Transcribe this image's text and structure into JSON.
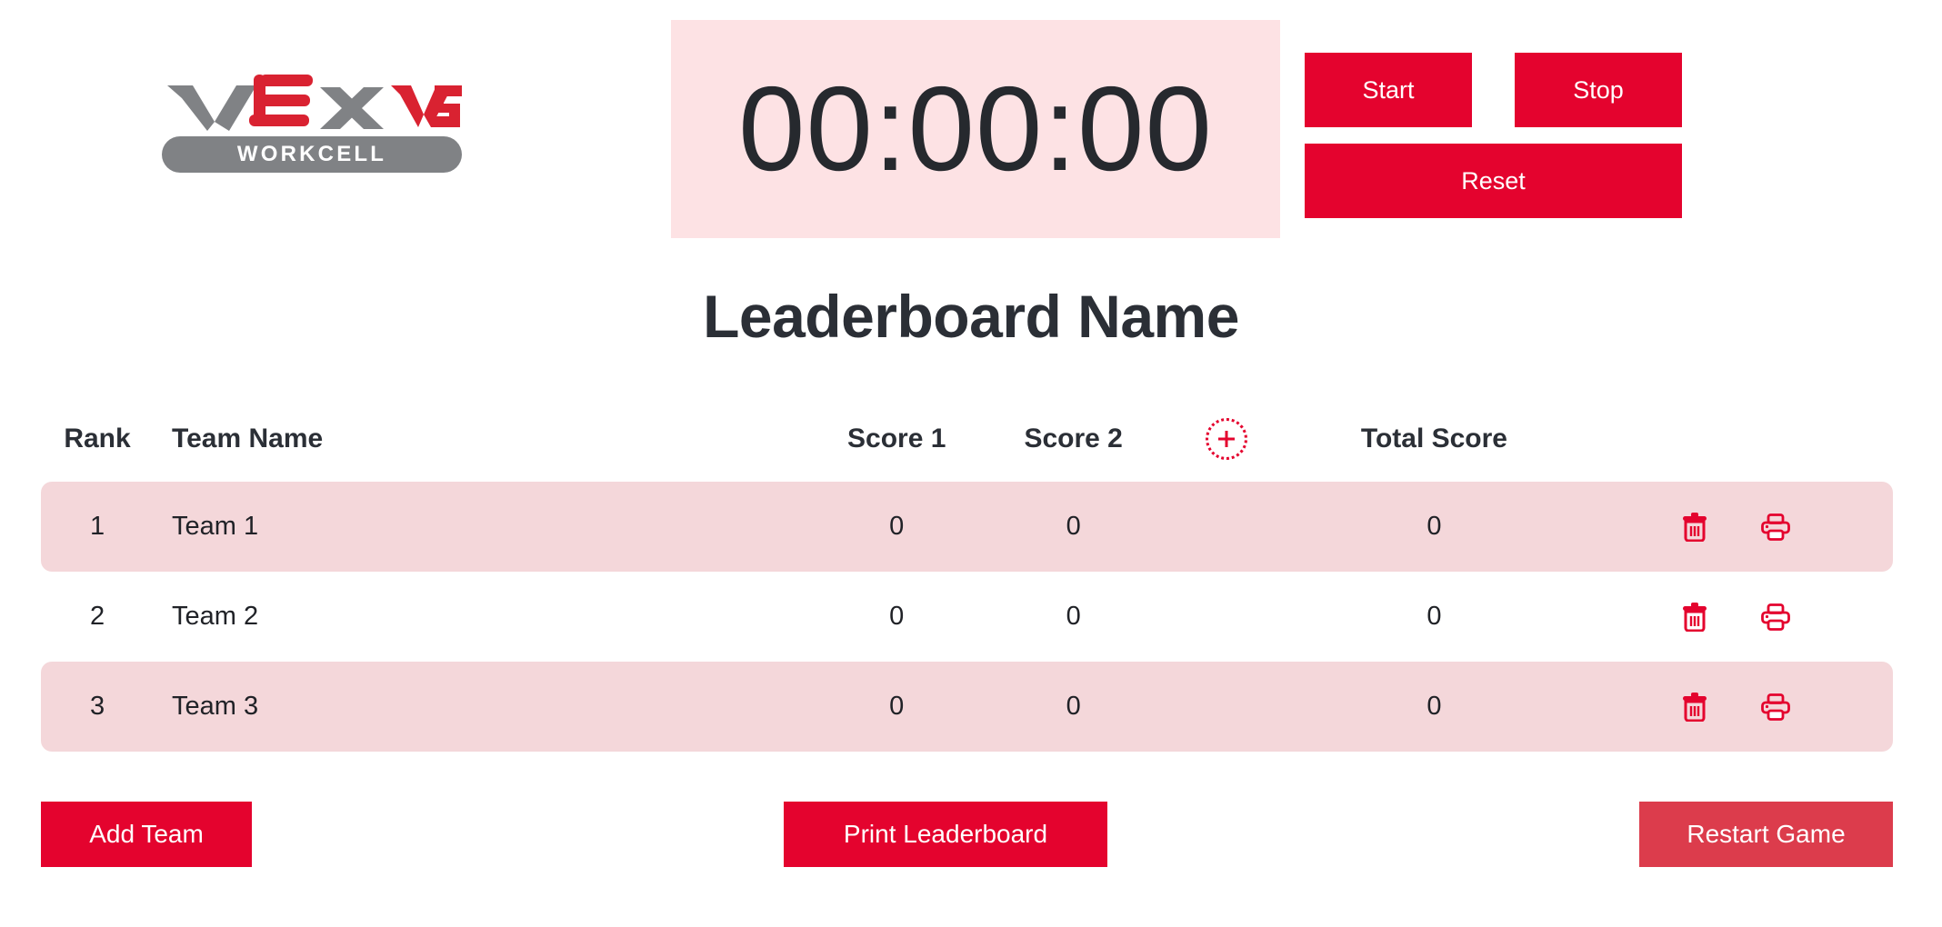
{
  "brand": {
    "logo_name": "VEX V5",
    "logo_sub": "WORKCELL",
    "logo_gray": "#808285",
    "logo_red": "#e4032e"
  },
  "timer": {
    "display": "00:00:00",
    "background": "#fde2e4",
    "text_color": "#26292e",
    "start_label": "Start",
    "stop_label": "Stop",
    "reset_label": "Reset",
    "button_color": "#e4032e"
  },
  "board": {
    "title": "Leaderboard Name",
    "headers": {
      "rank": "Rank",
      "team_name": "Team Name",
      "score1": "Score 1",
      "score2": "Score 2",
      "total": "Total Score",
      "add_column_icon": "plus-circle-dotted-icon"
    },
    "row_highlight_color": "#f4d7da",
    "rows": [
      {
        "rank": "1",
        "team": "Team 1",
        "score1": "0",
        "score2": "0",
        "total": "0",
        "delete_icon": "trash-icon",
        "print_icon": "printer-icon"
      },
      {
        "rank": "2",
        "team": "Team 2",
        "score1": "0",
        "score2": "0",
        "total": "0",
        "delete_icon": "trash-icon",
        "print_icon": "printer-icon"
      },
      {
        "rank": "3",
        "team": "Team 3",
        "score1": "0",
        "score2": "0",
        "total": "0",
        "delete_icon": "trash-icon",
        "print_icon": "printer-icon"
      }
    ]
  },
  "footer": {
    "add_team_label": "Add Team",
    "print_leaderboard_label": "Print Leaderboard",
    "restart_game_label": "Restart Game",
    "primary_color": "#e4032e",
    "restart_color": "#dc3c4c"
  }
}
